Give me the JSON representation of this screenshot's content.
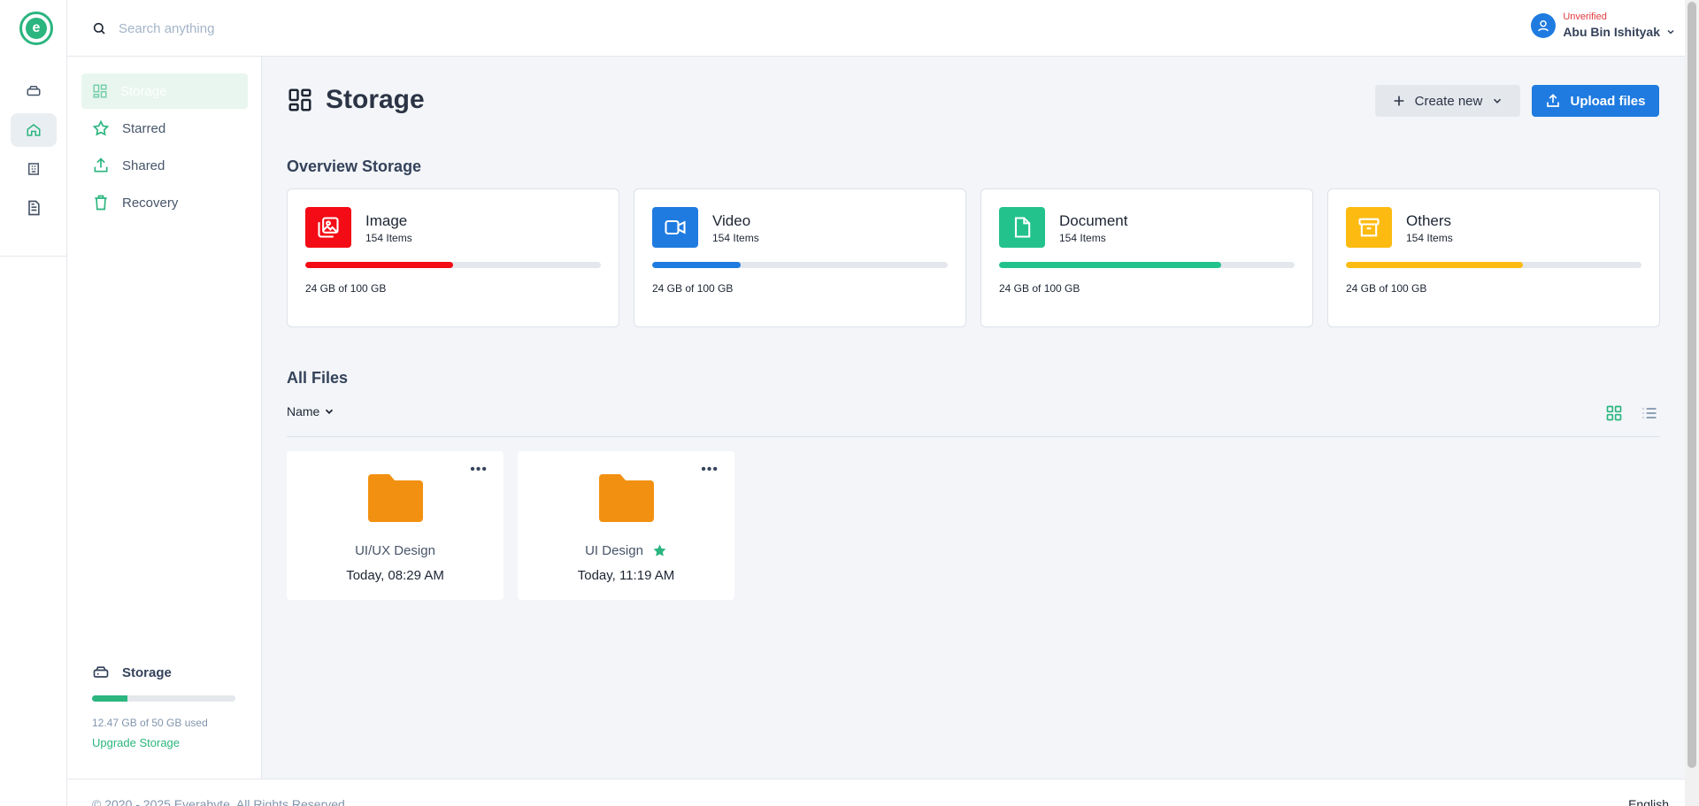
{
  "app": {
    "logo_letter": "e"
  },
  "search": {
    "placeholder": "Search anything",
    "value": ""
  },
  "user": {
    "status": "Unverified",
    "name": "Abu Bin Ishityak"
  },
  "sidebar": {
    "items": [
      {
        "label": "Storage",
        "icon": "grid-icon",
        "active": true
      },
      {
        "label": "Starred",
        "icon": "star-icon"
      },
      {
        "label": "Shared",
        "icon": "share-icon"
      },
      {
        "label": "Recovery",
        "icon": "trash-icon"
      }
    ],
    "storage": {
      "title": "Storage",
      "used_text": "12.47 GB of 50 GB used",
      "used_fraction": 0.2494,
      "upgrade_label": "Upgrade Storage"
    }
  },
  "main": {
    "title": "Storage",
    "create_label": "Create new",
    "upload_label": "Upload files",
    "overview_title": "Overview Storage",
    "cards": [
      {
        "name": "Image",
        "items": "154 Items",
        "usage": "24 GB of 100 GB",
        "progress": 0.5,
        "color": "#f30b15",
        "icon": "image-icon"
      },
      {
        "name": "Video",
        "items": "154 Items",
        "usage": "24 GB of 100 GB",
        "progress": 0.3,
        "color": "#1f7be0",
        "icon": "video-icon"
      },
      {
        "name": "Document",
        "items": "154 Items",
        "usage": "24 GB of 100 GB",
        "progress": 0.75,
        "color": "#23c28c",
        "icon": "document-icon"
      },
      {
        "name": "Others",
        "items": "154 Items",
        "usage": "24 GB of 100 GB",
        "progress": 0.6,
        "color": "#fdbb12",
        "icon": "archive-icon"
      }
    ],
    "files_title": "All Files",
    "sort_label": "Name",
    "files": [
      {
        "name": "UI/UX Design",
        "date": "Today, 08:29 AM",
        "starred": false
      },
      {
        "name": "UI Design",
        "date": "Today, 11:19 AM",
        "starred": true
      }
    ]
  },
  "footer": {
    "copyright": "© 2020 - 2025 Everabyte. All Rights Reserved",
    "language": "English"
  },
  "colors": {
    "accent": "#2bb57f",
    "primary": "#1f7be0",
    "folder": "#f29111"
  }
}
